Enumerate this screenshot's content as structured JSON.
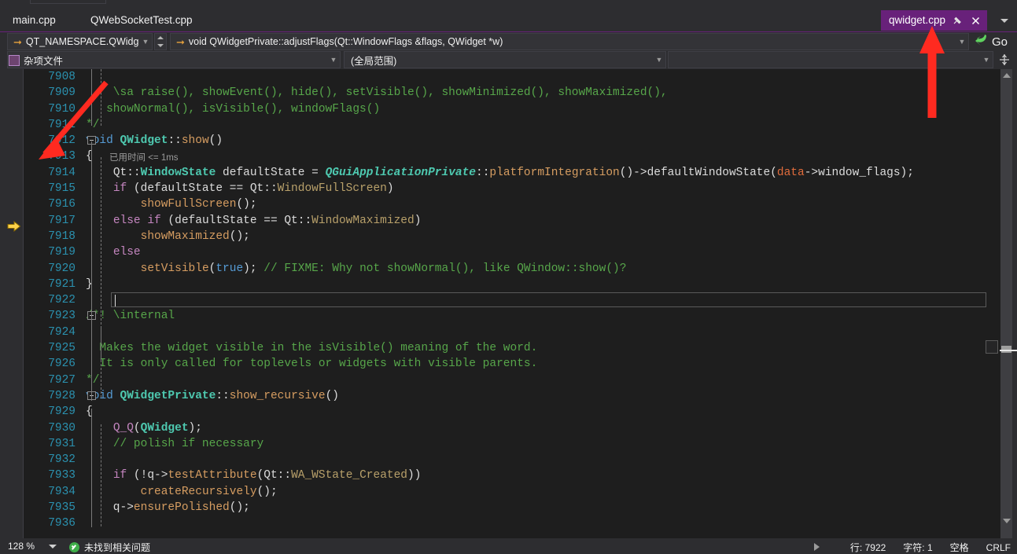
{
  "window": {
    "theme_bg": "#2d2d30",
    "editor_bg": "#1e1e1e",
    "accent": "#68217a"
  },
  "tabs": {
    "inactive": [
      {
        "label": "main.cpp"
      },
      {
        "label": "QWebSocketTest.cpp"
      }
    ],
    "active": {
      "label": "qwidget.cpp",
      "pin_icon": "pin-icon",
      "close_icon": "close-icon"
    },
    "overflow_icon": "chevron-down-icon"
  },
  "navbar": {
    "scope_combo": {
      "value": "QT_NAMESPACE.QWidg",
      "icon": "arrow-right-icon",
      "caret": "chevron-down-icon"
    },
    "spinner": {
      "up_icon": "spin-up-icon",
      "down_icon": "spin-down-icon"
    },
    "function_combo": {
      "value": "void QWidgetPrivate::adjustFlags(Qt::WindowFlags &flags, QWidget *w)",
      "icon": "arrow-right-icon",
      "caret": "chevron-down-icon"
    },
    "go_button": {
      "label": "Go",
      "icon": "go-arrow-icon"
    }
  },
  "navbar2": {
    "misc_file": {
      "label": "杂项文件",
      "icon": "misc-file-icon"
    },
    "filter_combo": {
      "value": "",
      "caret": "chevron-down-icon"
    },
    "global_combo": {
      "value": "(全局范围)",
      "caret": "chevron-down-icon"
    },
    "blank_combo": {
      "value": "",
      "caret": "chevron-down-icon"
    },
    "split_button": {
      "icon": "split-view-icon"
    }
  },
  "editor": {
    "first_line": 7908,
    "exec_pointer_line": 7913,
    "current_line": 7922,
    "elapsed_label": "已用时间 <= 1ms",
    "lines": [
      {
        "n": 7908,
        "tokens": []
      },
      {
        "n": 7909,
        "tokens": [
          {
            "t": "    \\sa raise(), showEvent(), hide(), setVisible(), showMinimized(), showMaximized(),",
            "c": "c-com"
          }
        ]
      },
      {
        "n": 7910,
        "tokens": [
          {
            "t": "   showNormal(), isVisible(), windowFlags()",
            "c": "c-com"
          }
        ]
      },
      {
        "n": 7911,
        "tokens": [
          {
            "t": "*/",
            "c": "c-com"
          }
        ]
      },
      {
        "n": 7912,
        "tokens": [
          {
            "t": "void ",
            "c": "c-kw"
          },
          {
            "t": "QWidget",
            "c": "c-type"
          },
          {
            "t": "::",
            "c": "c-punct"
          },
          {
            "t": "show",
            "c": "c-fn"
          },
          {
            "t": "()",
            "c": "c-punct"
          }
        ]
      },
      {
        "n": 7913,
        "tokens": [
          {
            "t": "{",
            "c": "c-punct"
          }
        ]
      },
      {
        "n": 7914,
        "tokens": [
          {
            "t": "    ",
            "c": "c-plain"
          },
          {
            "t": "Qt",
            "c": "c-plain"
          },
          {
            "t": "::",
            "c": "c-punct"
          },
          {
            "t": "WindowState",
            "c": "c-type"
          },
          {
            "t": " defaultState = ",
            "c": "c-plain"
          },
          {
            "t": "QGuiApplicationPrivate",
            "c": "c-typei"
          },
          {
            "t": "::",
            "c": "c-punct"
          },
          {
            "t": "platformIntegration",
            "c": "c-fn"
          },
          {
            "t": "()->",
            "c": "c-punct"
          },
          {
            "t": "defaultWindowState",
            "c": "c-plain"
          },
          {
            "t": "(",
            "c": "c-punct"
          },
          {
            "t": "data",
            "c": "c-param"
          },
          {
            "t": "->",
            "c": "c-punct"
          },
          {
            "t": "window_flags",
            "c": "c-plain"
          },
          {
            "t": ");",
            "c": "c-punct"
          }
        ]
      },
      {
        "n": 7915,
        "tokens": [
          {
            "t": "    ",
            "c": "c-plain"
          },
          {
            "t": "if",
            "c": "c-kw2"
          },
          {
            "t": " (defaultState == Qt::",
            "c": "c-plain"
          },
          {
            "t": "WindowFullScreen",
            "c": "c-enum"
          },
          {
            "t": ")",
            "c": "c-punct"
          }
        ]
      },
      {
        "n": 7916,
        "tokens": [
          {
            "t": "        ",
            "c": "c-plain"
          },
          {
            "t": "showFullScreen",
            "c": "c-fn"
          },
          {
            "t": "();",
            "c": "c-punct"
          }
        ]
      },
      {
        "n": 7917,
        "tokens": [
          {
            "t": "    ",
            "c": "c-plain"
          },
          {
            "t": "else if",
            "c": "c-kw2"
          },
          {
            "t": " (defaultState == Qt::",
            "c": "c-plain"
          },
          {
            "t": "WindowMaximized",
            "c": "c-enum"
          },
          {
            "t": ")",
            "c": "c-punct"
          }
        ]
      },
      {
        "n": 7918,
        "tokens": [
          {
            "t": "        ",
            "c": "c-plain"
          },
          {
            "t": "showMaximized",
            "c": "c-fn"
          },
          {
            "t": "();",
            "c": "c-punct"
          }
        ]
      },
      {
        "n": 7919,
        "tokens": [
          {
            "t": "    ",
            "c": "c-plain"
          },
          {
            "t": "else",
            "c": "c-kw2"
          }
        ]
      },
      {
        "n": 7920,
        "tokens": [
          {
            "t": "        ",
            "c": "c-plain"
          },
          {
            "t": "setVisible",
            "c": "c-fn"
          },
          {
            "t": "(",
            "c": "c-punct"
          },
          {
            "t": "true",
            "c": "c-kw"
          },
          {
            "t": "); ",
            "c": "c-punct"
          },
          {
            "t": "// FIXME: Why not showNormal(), like QWindow::show()?",
            "c": "c-com"
          }
        ]
      },
      {
        "n": 7921,
        "tokens": [
          {
            "t": "}",
            "c": "c-punct"
          }
        ]
      },
      {
        "n": 7922,
        "tokens": []
      },
      {
        "n": 7923,
        "tokens": [
          {
            "t": "/*! \\internal",
            "c": "c-com"
          }
        ]
      },
      {
        "n": 7924,
        "tokens": []
      },
      {
        "n": 7925,
        "tokens": [
          {
            "t": "  Makes the widget visible in the isVisible() meaning of the word.",
            "c": "c-com"
          }
        ]
      },
      {
        "n": 7926,
        "tokens": [
          {
            "t": "  It is only called for toplevels or widgets with visible parents.",
            "c": "c-com"
          }
        ]
      },
      {
        "n": 7927,
        "tokens": [
          {
            "t": "*/",
            "c": "c-com"
          }
        ]
      },
      {
        "n": 7928,
        "tokens": [
          {
            "t": "void ",
            "c": "c-kw"
          },
          {
            "t": "QWidgetPrivate",
            "c": "c-type"
          },
          {
            "t": "::",
            "c": "c-punct"
          },
          {
            "t": "show_recursive",
            "c": "c-fn"
          },
          {
            "t": "()",
            "c": "c-punct"
          }
        ]
      },
      {
        "n": 7929,
        "tokens": [
          {
            "t": "{",
            "c": "c-punct"
          }
        ]
      },
      {
        "n": 7930,
        "tokens": [
          {
            "t": "    ",
            "c": "c-plain"
          },
          {
            "t": "Q_Q",
            "c": "c-macro"
          },
          {
            "t": "(",
            "c": "c-punct"
          },
          {
            "t": "QWidget",
            "c": "c-type"
          },
          {
            "t": ");",
            "c": "c-punct"
          }
        ]
      },
      {
        "n": 7931,
        "tokens": [
          {
            "t": "    ",
            "c": "c-plain"
          },
          {
            "t": "// polish if necessary",
            "c": "c-com"
          }
        ]
      },
      {
        "n": 7932,
        "tokens": []
      },
      {
        "n": 7933,
        "tokens": [
          {
            "t": "    ",
            "c": "c-plain"
          },
          {
            "t": "if",
            "c": "c-kw2"
          },
          {
            "t": " (!q->",
            "c": "c-plain"
          },
          {
            "t": "testAttribute",
            "c": "c-fn"
          },
          {
            "t": "(Qt::",
            "c": "c-plain"
          },
          {
            "t": "WA_WState_Created",
            "c": "c-enum"
          },
          {
            "t": "))",
            "c": "c-punct"
          }
        ]
      },
      {
        "n": 7934,
        "tokens": [
          {
            "t": "        ",
            "c": "c-plain"
          },
          {
            "t": "createRecursively",
            "c": "c-fn"
          },
          {
            "t": "();",
            "c": "c-punct"
          }
        ]
      },
      {
        "n": 7935,
        "tokens": [
          {
            "t": "    q->",
            "c": "c-plain"
          },
          {
            "t": "ensurePolished",
            "c": "c-fn"
          },
          {
            "t": "();",
            "c": "c-punct"
          }
        ]
      },
      {
        "n": 7936,
        "tokens": []
      }
    ]
  },
  "statusbar": {
    "zoom": "128 %",
    "issues": "未找到相关问题",
    "line_label": "行: 7922",
    "char_label": "字符: 1",
    "indent_label": "空格",
    "eol_label": "CRLF"
  },
  "annotations": {
    "arrow_color": "#ff2a20",
    "arrow_1_target": "line-7912-gutter",
    "arrow_2_target": "active-tab"
  }
}
